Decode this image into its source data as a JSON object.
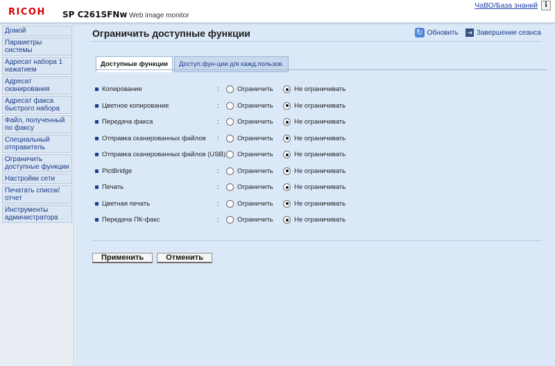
{
  "header": {
    "logo": "RICOH",
    "model": "SP C261SFNw",
    "subtitle": "Web image monitor",
    "faq_link": "ЧаВО/База знаний",
    "info_icon_glyph": "i"
  },
  "sidebar": {
    "items": [
      {
        "label": "Домой"
      },
      {
        "label": "Параметры системы"
      },
      {
        "label": "Адресат набора 1 нажатием"
      },
      {
        "label": "Адресат сканирования"
      },
      {
        "label": "Адресат факса быстрого набора"
      },
      {
        "label": "Файл, полученный по факсу"
      },
      {
        "label": "Специальный отправитель"
      },
      {
        "label": "Ограничить доступные функции"
      },
      {
        "label": "Настройки сети"
      },
      {
        "label": "Печатать список/отчет"
      },
      {
        "label": "Инструменты администратора"
      }
    ]
  },
  "main": {
    "title": "Ограничить доступные функции",
    "actions": {
      "refresh_label": "Обновить",
      "refresh_icon": "refresh-icon",
      "logout_label": "Завершение сеанса",
      "logout_icon": "logout-icon"
    },
    "tabs": [
      {
        "label": "Доступные функции",
        "active": true
      },
      {
        "label": "Доступ.фун-ции д/я кажд.пользов.",
        "active": false
      }
    ],
    "colon": ":",
    "option_restrict": "Ограничить",
    "option_unrestricted": "Не ограничивать",
    "functions": [
      {
        "label": "Копирование",
        "selected": "unrestricted"
      },
      {
        "label": "Цветное копирование",
        "selected": "unrestricted"
      },
      {
        "label": "Передача факса",
        "selected": "unrestricted"
      },
      {
        "label": "Отправка сканированных файлов",
        "selected": "unrestricted"
      },
      {
        "label": "Отправка сканированных файлов (USB)",
        "selected": "unrestricted"
      },
      {
        "label": "PictBridge",
        "selected": "unrestricted"
      },
      {
        "label": "Печать",
        "selected": "unrestricted"
      },
      {
        "label": "Цветная печать",
        "selected": "unrestricted"
      },
      {
        "label": "Передача ПК-факс",
        "selected": "unrestricted"
      }
    ],
    "buttons": {
      "apply": "Применить",
      "cancel": "Отменить"
    }
  },
  "colors": {
    "brand_red": "#d50000",
    "main_bg": "#dbe8f8",
    "link_blue": "#1a3a86"
  }
}
